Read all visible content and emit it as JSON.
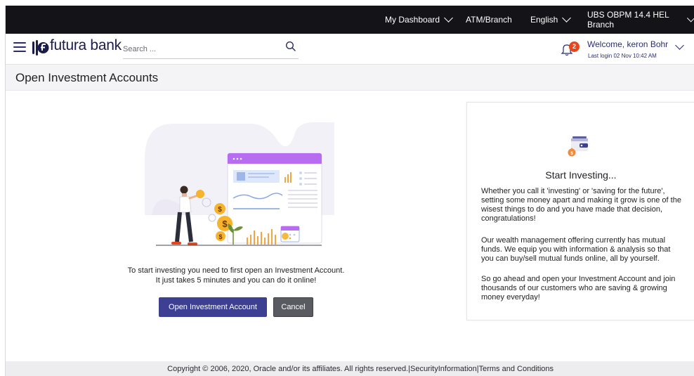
{
  "topbar": {
    "dashboard": "My Dashboard",
    "atm_branch": "ATM/Branch",
    "language": "English",
    "branch": "UBS OBPM 14.4 HEL Branch"
  },
  "header": {
    "brand": "futura bank",
    "search_placeholder": "Search ...",
    "notification_count": "2",
    "welcome": "Welcome, keron Bohr",
    "last_login": "Last login 02 Nov 10:42 AM"
  },
  "page": {
    "title": "Open Investment Accounts"
  },
  "main": {
    "intro_line1": "To start investing you need to first open an Investment Account.",
    "intro_line2": "It just takes 5 minutes and you can do it online!",
    "open_button": "Open Investment Account",
    "cancel_button": "Cancel"
  },
  "card": {
    "title": "Start Investing...",
    "para1": "Whether you call it 'investing' or 'saving for the future', setting some money apart and making it grow is one of the wisest things to do and you have made that decision, congratulations!",
    "para2": "Our wealth management offering currently has mutual funds. We equip you with information & analysis so that you can buy/sell mutual funds online, all by yourself.",
    "para3": "So go ahead and open your Investment Account and join thousands of our customers who are saving & growing money everyday!"
  },
  "footer": {
    "copyright": "Copyright © 2006, 2020, Oracle and/or its affiliates. All rights reserved.",
    "separator": "|",
    "security": "SecurityInformation",
    "terms": "Terms and Conditions"
  },
  "colors": {
    "topbar": "#131318",
    "brand_navy": "#2c2d6b",
    "primary_button": "#3c3f92",
    "cancel_button": "#5a5b61",
    "badge": "#e8451d",
    "accent_purple": "#b86cf0"
  },
  "icons": {
    "menu": "hamburger-icon",
    "search": "search-icon",
    "notifications": "bell-icon",
    "card": "wallet-icon",
    "dropdown": "chevron-down-icon"
  }
}
